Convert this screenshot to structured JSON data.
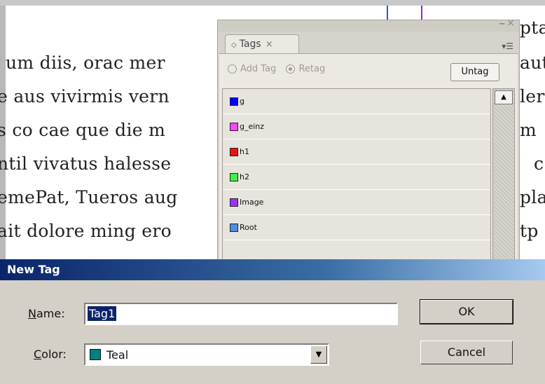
{
  "document": {
    "lines": [
      "um diis, orac mer",
      "e aus vivirmis vern",
      "s co cae que die m",
      "ntil vivatus halesse",
      "emePat, Tueros aug",
      "ait dolore ming ero"
    ],
    "right_fragments": [
      "aut",
      "ler",
      "m",
      "c",
      "pla",
      "tp",
      "pta"
    ]
  },
  "tags_panel": {
    "tab_label": "Tags",
    "close_glyph": "×",
    "add_tag_label": "Add Tag",
    "retag_label": "Retag",
    "untag_label": "Untag",
    "tags": [
      {
        "name": "g",
        "color": "#0000ff"
      },
      {
        "name": "g_einz",
        "color": "#ff44ff"
      },
      {
        "name": "h1",
        "color": "#ee1111"
      },
      {
        "name": "h2",
        "color": "#44ee44"
      },
      {
        "name": "Image",
        "color": "#9b30ff"
      },
      {
        "name": "Root",
        "color": "#4a90e2"
      }
    ]
  },
  "dialog": {
    "title": "New Tag",
    "name_label_u": "N",
    "name_label_rest": "ame:",
    "name_value": "Tag1",
    "color_label_u": "C",
    "color_label_rest": "olor:",
    "color_value": "Teal",
    "color_swatch": "#008080",
    "ok_label": "OK",
    "cancel_label": "Cancel"
  }
}
